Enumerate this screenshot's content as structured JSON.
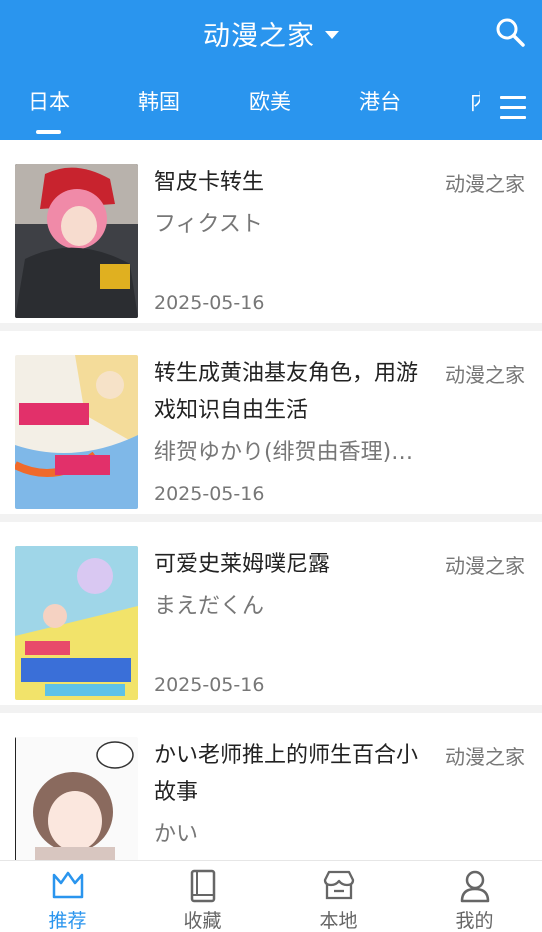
{
  "header": {
    "title": "动漫之家"
  },
  "tabs": [
    {
      "label": "日本",
      "active": true
    },
    {
      "label": "韩国"
    },
    {
      "label": "欧美"
    },
    {
      "label": "港台"
    },
    {
      "label": "内地"
    }
  ],
  "items": [
    {
      "title": "智皮卡转生",
      "author": "フィクスト",
      "source": "动漫之家",
      "date": "2025-05-16"
    },
    {
      "title": "转生成黄油基友角色，用游戏知识自由生活",
      "author": "绯贺ゆかり(绯贺由香理)…",
      "source": "动漫之家",
      "date": "2025-05-16"
    },
    {
      "title": "可爱史莱姆噗尼露",
      "author": "まえだくん",
      "source": "动漫之家",
      "date": "2025-05-16"
    },
    {
      "title": "かい老师推上的师生百合小故事",
      "author": "かい",
      "source": "动漫之家",
      "date": ""
    }
  ],
  "bottom_nav": [
    {
      "label": "推荐",
      "icon": "crown-icon",
      "active": true
    },
    {
      "label": "收藏",
      "icon": "book-icon"
    },
    {
      "label": "本地",
      "icon": "store-icon"
    },
    {
      "label": "我的",
      "icon": "person-icon"
    }
  ],
  "colors": {
    "primary": "#2a95ee",
    "text": "#222222",
    "secondary_text": "#777777"
  }
}
